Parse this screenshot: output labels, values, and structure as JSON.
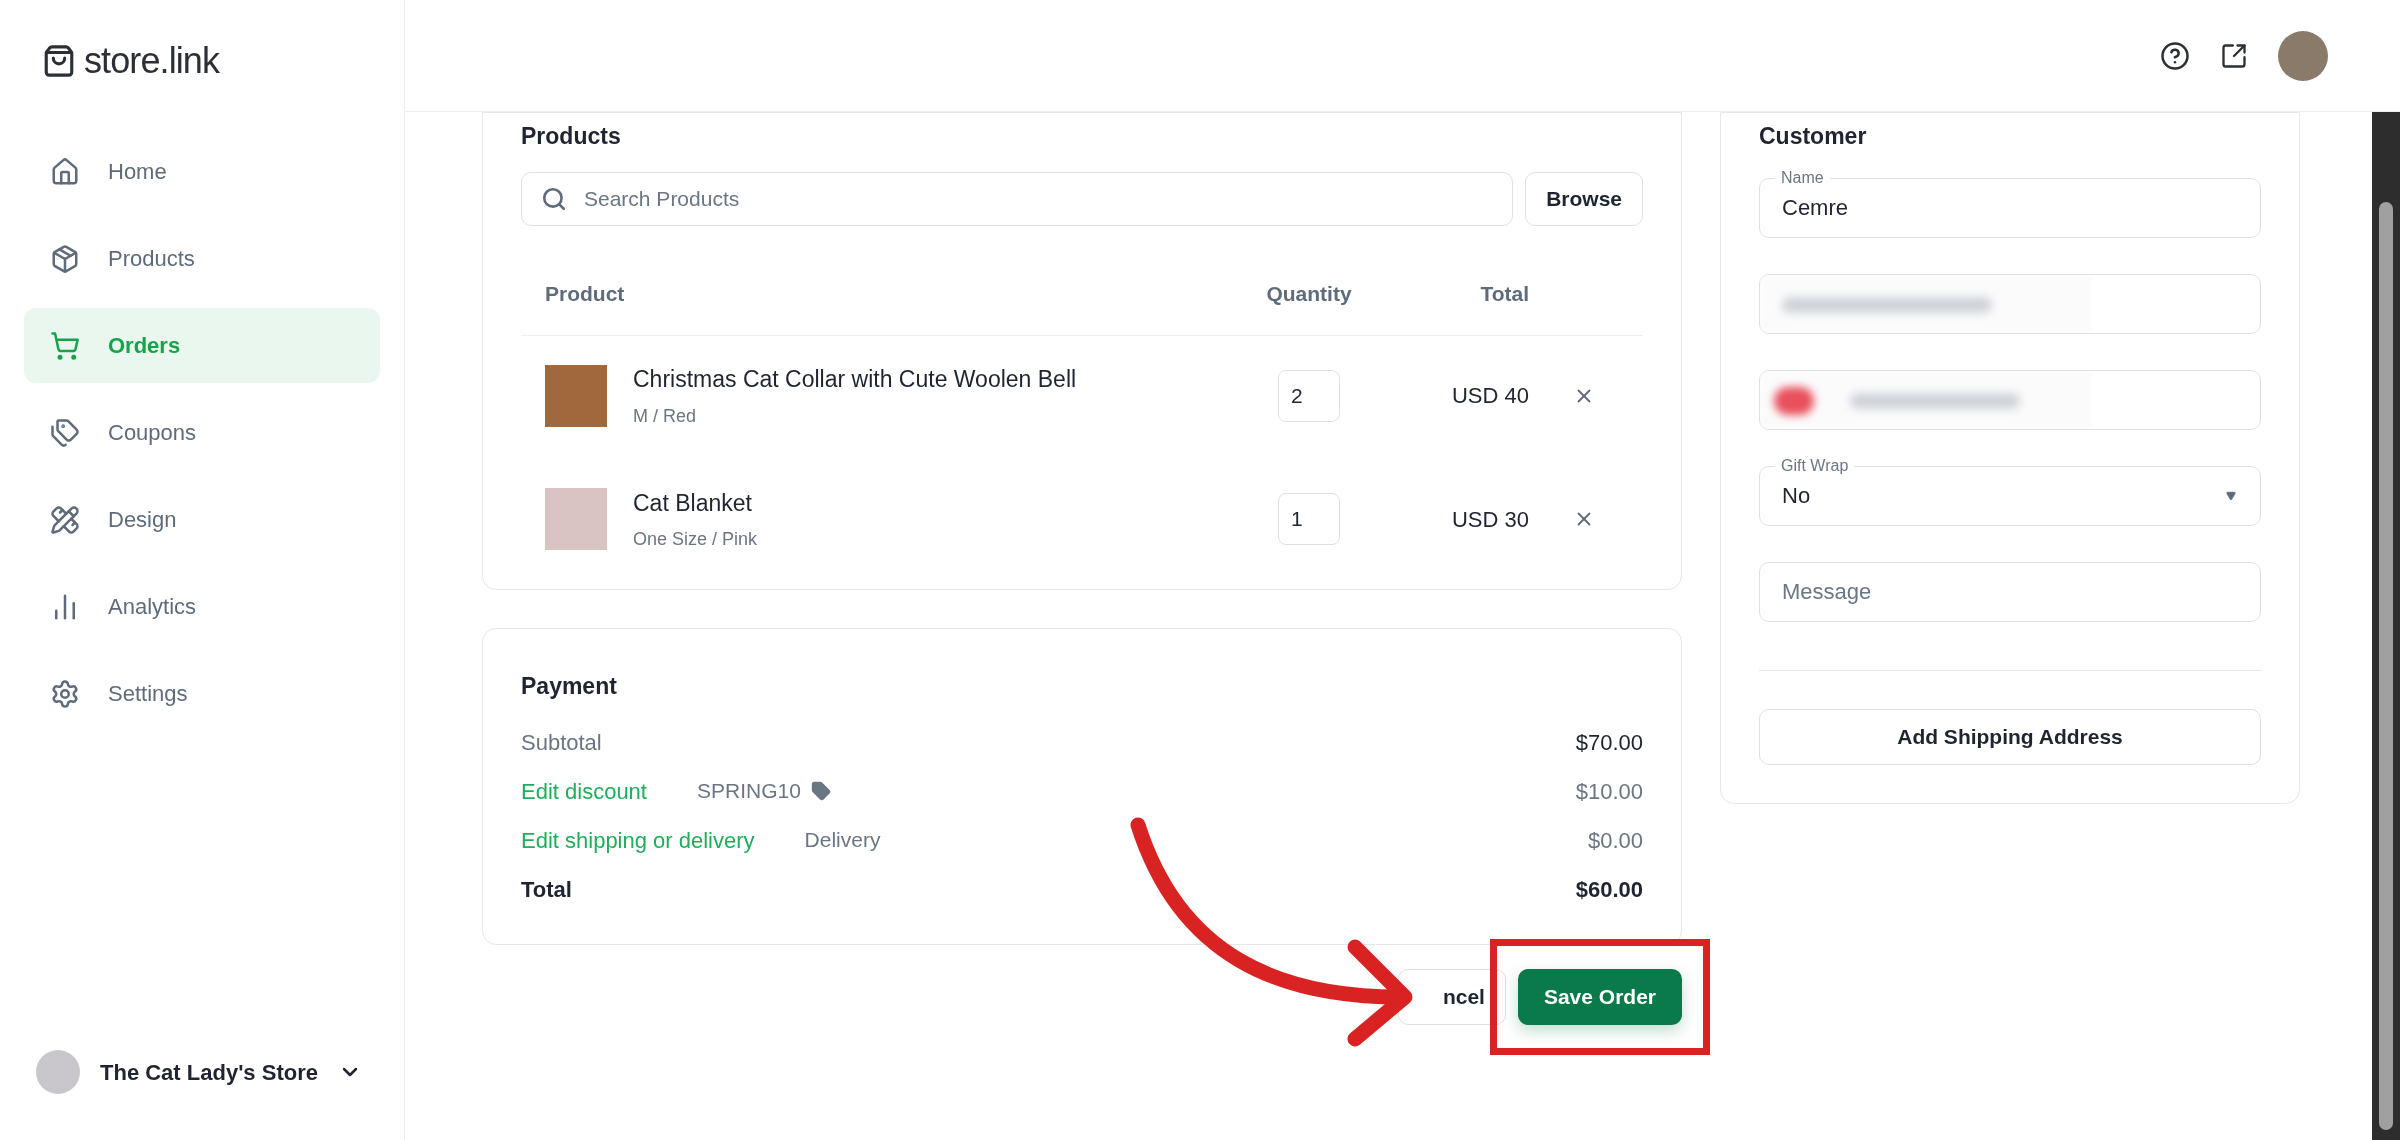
{
  "brand": {
    "name": "store.link"
  },
  "sidebar": {
    "items": [
      {
        "label": "Home",
        "selected": false
      },
      {
        "label": "Products",
        "selected": false
      },
      {
        "label": "Orders",
        "selected": true
      },
      {
        "label": "Coupons",
        "selected": false
      },
      {
        "label": "Design",
        "selected": false
      },
      {
        "label": "Analytics",
        "selected": false
      },
      {
        "label": "Settings",
        "selected": false
      }
    ],
    "store": {
      "name": "The Cat Lady's Store"
    }
  },
  "products": {
    "title": "Products",
    "search": {
      "placeholder": "Search Products"
    },
    "browse_button": "Browse",
    "table": {
      "columns": [
        "Product",
        "Quantity",
        "Total"
      ],
      "rows": [
        {
          "name": "Christmas Cat Collar with Cute Woolen Bell",
          "variant": "M / Red",
          "quantity": "2",
          "total": "USD 40"
        },
        {
          "name": "Cat Blanket",
          "variant": "One Size / Pink",
          "quantity": "1",
          "total": "USD 30"
        }
      ]
    }
  },
  "payment": {
    "title": "Payment",
    "rows": [
      {
        "kind": "plain",
        "label": "Subtotal",
        "amount": "$70.00"
      },
      {
        "kind": "link",
        "label": "Edit discount",
        "detail": "SPRING10",
        "amount": "$10.00"
      },
      {
        "kind": "link",
        "label": "Edit shipping or delivery",
        "detail": "Delivery",
        "amount": "$0.00"
      },
      {
        "kind": "total",
        "label": "Total",
        "amount": "$60.00"
      }
    ]
  },
  "actions": {
    "cancel": "ncel",
    "save": "Save Order"
  },
  "customer": {
    "title": "Customer",
    "fields": [
      {
        "kind": "text",
        "label": "Name",
        "value": "Cemre"
      },
      {
        "kind": "redacted"
      },
      {
        "kind": "redacted_phone"
      },
      {
        "kind": "select",
        "label": "Gift Wrap",
        "value": "No"
      },
      {
        "kind": "text",
        "placeholder": "Message"
      }
    ],
    "add_shipping_button": "Add Shipping Address"
  }
}
